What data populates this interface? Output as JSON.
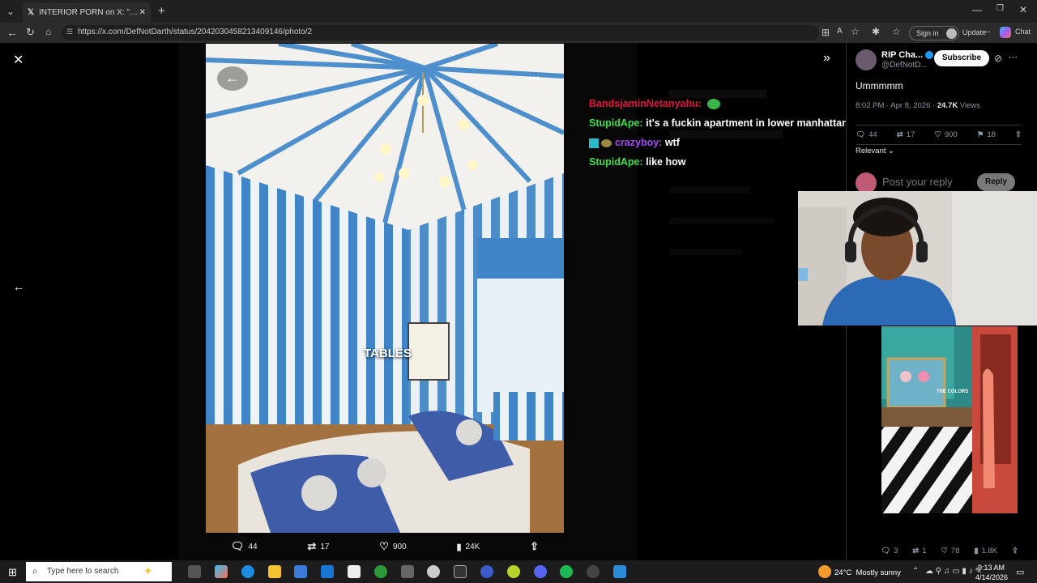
{
  "browser": {
    "tab_title": "INTERIOR PORN on X: \"how is it e",
    "url": "https://x.com/DefNotDarth/status/2042030458213409146/photo/2",
    "sign_in": "Sign in",
    "update": "Update",
    "chat": "Chat"
  },
  "overlay": {
    "image_caption": "TABLES"
  },
  "chat_overlay": [
    {
      "user": "BandsjaminNetanyahu",
      "message": "",
      "color": "#e5123b"
    },
    {
      "user": "StupidApe",
      "message": "it's a fuckin apartment in lower manhattan tho",
      "color": "#3ee04a"
    },
    {
      "user": "crazyboy",
      "message": "wtf",
      "color": "#a24bf2"
    },
    {
      "user": "StupidApe",
      "message": "like how",
      "color": "#3ee04a"
    }
  ],
  "media_actions": {
    "replies": "44",
    "reposts": "17",
    "likes": "900",
    "views": "24K"
  },
  "tweet": {
    "author_name": "RIP Cha...",
    "author_handle": "@DefNotD...",
    "subscribe": "Subscribe",
    "text": "Ummmmm",
    "time": "8:02 PM · Apr 8, 2026 · ",
    "views_count": "24.7K",
    "views_label": "Views",
    "replies": "44",
    "reposts": "17",
    "likes": "900",
    "bookmarks": "18",
    "sort": "Relevant",
    "reply_placeholder": "Post your reply",
    "reply_button": "Reply"
  },
  "clip": {
    "caption": "THE COLORS",
    "replies": "3",
    "reposts": "1",
    "likes": "78",
    "views": "1.8K"
  },
  "taskbar": {
    "search_placeholder": "Type here to search",
    "weather": "24°C  Mostly sunny",
    "time": "9:13 AM",
    "date": "4/14/2026"
  }
}
